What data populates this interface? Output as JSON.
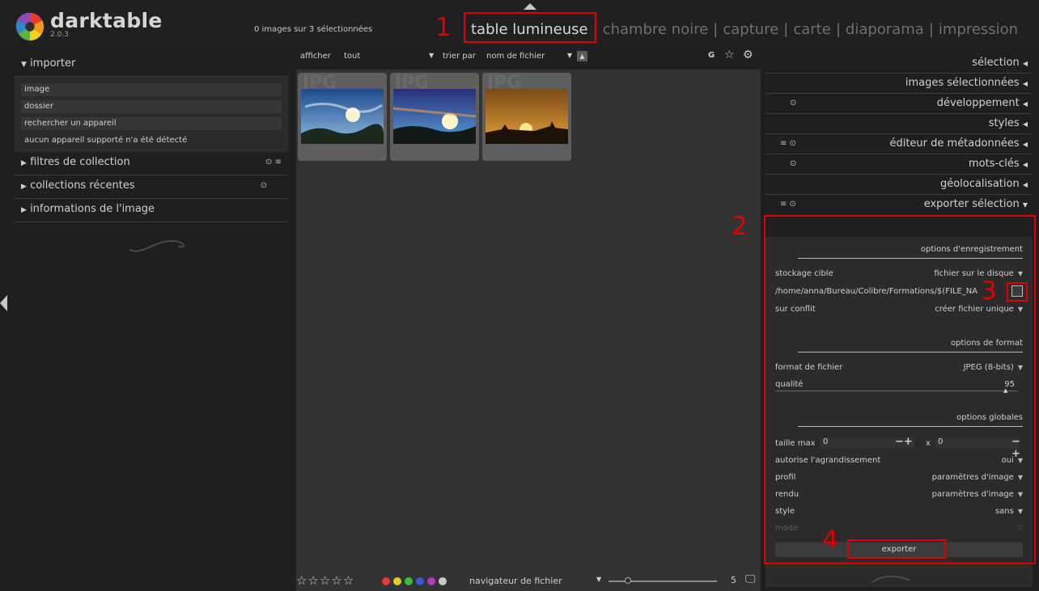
{
  "app": {
    "name": "darktable",
    "version": "2.0.3"
  },
  "header": {
    "selection_count": "0 images sur 3 sélectionnées",
    "views": [
      "table lumineuse",
      "chambre noire",
      "capture",
      "carte",
      "diaporama",
      "impression"
    ],
    "active_view": "table lumineuse"
  },
  "left_panel": {
    "importer": {
      "label": "importer",
      "items": [
        "image",
        "dossier",
        "rechercher un appareil"
      ],
      "note": "aucun appareil supporté n'a été détecté"
    },
    "filters": {
      "label": "filtres de collection"
    },
    "recent": {
      "label": "collections récentes"
    },
    "info": {
      "label": "informations de l'image"
    }
  },
  "toolbar": {
    "show_label": "afficher",
    "show_value": "tout",
    "sort_label": "trier par",
    "sort_value": "nom de fichier",
    "grouping": "G"
  },
  "thumbnails": [
    {
      "ghost": "JPG",
      "sky_top": "#1e4a8c",
      "sky_bottom": "#8fbde0",
      "sun": "#f7f2d0"
    },
    {
      "ghost": "JPG",
      "sky_top": "#28307a",
      "sky_bottom": "#5aa0d8",
      "sun": "#fff6c8"
    },
    {
      "ghost": "JPG",
      "sky_top": "#7a4a18",
      "sky_bottom": "#e7a03a",
      "sun": "#ffe890"
    }
  ],
  "bottom_bar": {
    "stars": "☆☆☆☆☆",
    "color_labels": [
      "#e23b3b",
      "#d6cf30",
      "#3bbb3b",
      "#3757d6",
      "#b03bbb",
      "#c8c8c8"
    ],
    "navigator": "navigateur de fichier",
    "zoom_value": "5"
  },
  "right_panel": {
    "sections": [
      "sélection",
      "images sélectionnées",
      "développement",
      "styles",
      "éditeur de métadonnées",
      "mots-clés",
      "géolocalisation"
    ],
    "export": {
      "title": "exporter sélection",
      "storage_heading": "options d'enregistrement",
      "target_label": "stockage cible",
      "target_value": "fichier sur le disque",
      "path": "/home/anna/Bureau/Colibre/Formations/$(FILE_NA",
      "conflict_label": "sur conflit",
      "conflict_value": "créer fichier unique",
      "format_heading": "options de format",
      "file_format_label": "format de fichier",
      "file_format_value": "JPEG (8-bits)",
      "quality_label": "qualité",
      "quality_value": "95",
      "global_heading": "options globales",
      "max_size_label": "taille max",
      "max_w": "0",
      "max_h": "0",
      "upscale_label": "autorise l'agrandissement",
      "upscale_value": "oui",
      "profile_label": "profil",
      "profile_value": "paramètres d'image",
      "intent_label": "rendu",
      "intent_value": "paramètres d'image",
      "style_label": "style",
      "style_value": "sans",
      "mode_label": "mode",
      "export_button": "exporter"
    }
  },
  "annotations": [
    "1",
    "2",
    "3",
    "4"
  ]
}
